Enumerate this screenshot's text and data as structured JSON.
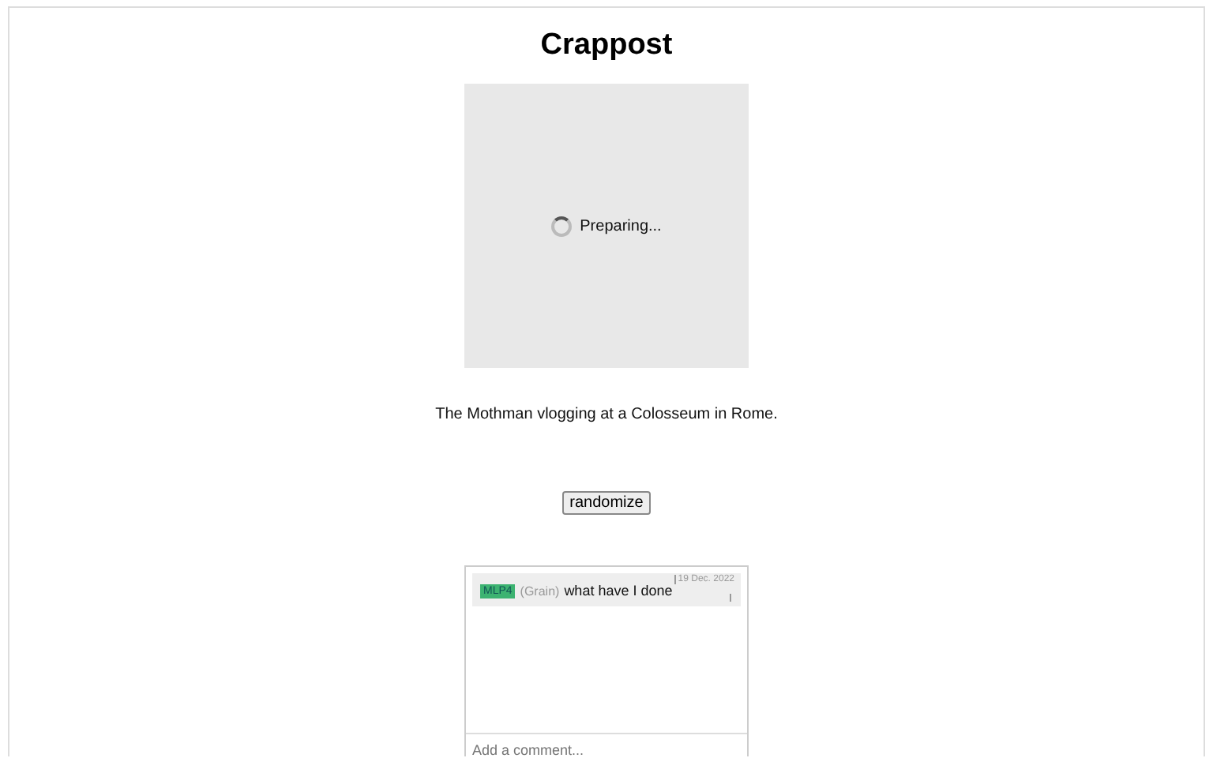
{
  "title": "Crappost",
  "preview": {
    "status": "Preparing..."
  },
  "caption": "The Mothman vlogging at a Colosseum in Rome.",
  "button": "randomize",
  "comments": [
    {
      "tag": "MLP4",
      "color": "#3cb371",
      "author": "(Grain)",
      "text": "what have I done",
      "date": "19 Dec. 2022"
    }
  ],
  "comment_field": {
    "placeholder": "Add a comment..."
  }
}
